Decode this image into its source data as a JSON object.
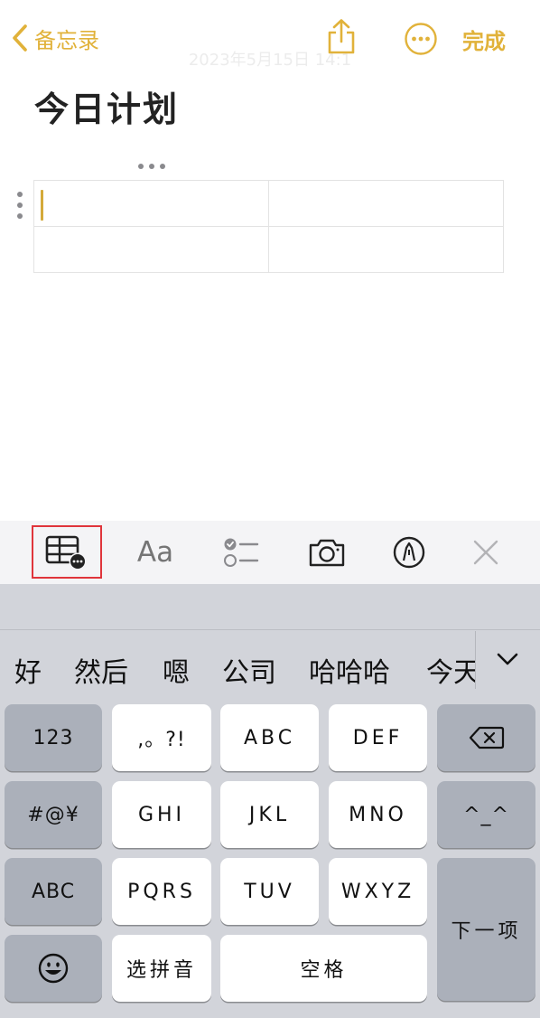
{
  "nav": {
    "back_label": "备忘录",
    "done_label": "完成",
    "date_faint": "2023年5月15日 14:1"
  },
  "note": {
    "title": "今日计划"
  },
  "toolbar": {
    "text_style_label": "Aa"
  },
  "keyboard": {
    "suggestions": [
      "好",
      "然后",
      "嗯",
      "公司",
      "哈哈哈",
      "今天"
    ],
    "keys": {
      "numbers": "123",
      "punct": ",。?!",
      "abc_key": "ABC",
      "def_key": "DEF",
      "symbols": "#@¥",
      "ghi_key": "GHI",
      "jkl_key": "JKL",
      "mno_key": "MNO",
      "emoticon": "^_^",
      "abc_switch": "ABC",
      "pqrs_key": "PQRS",
      "tuv_key": "TUV",
      "wxyz_key": "WXYZ",
      "next_key": "下一项",
      "pinyin_key": "选拼音",
      "space_key": "空格"
    }
  },
  "colors": {
    "accent": "#E1B23A",
    "highlight_box": "#E0353B",
    "keyboard_bg": "#d2d4da",
    "dark_key": "#abb0ba"
  }
}
